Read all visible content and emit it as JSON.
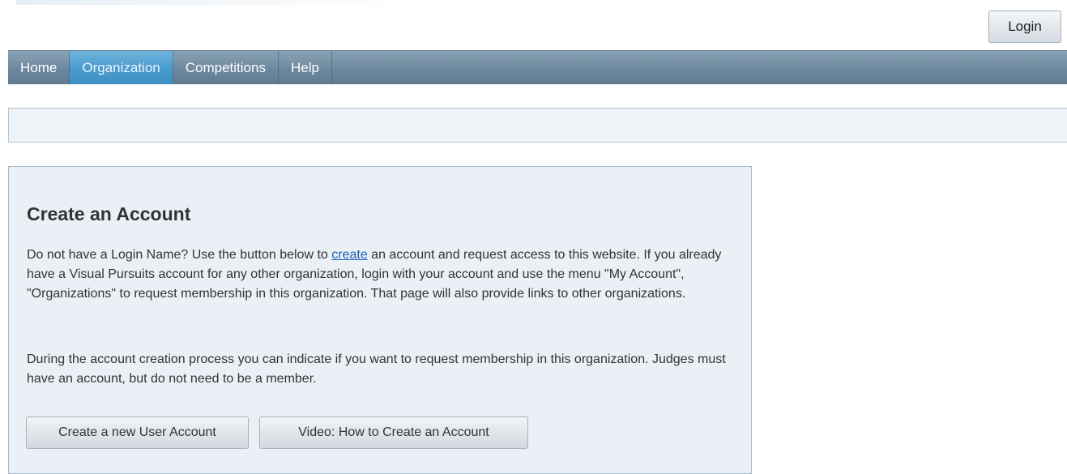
{
  "header": {
    "login_label": "Login"
  },
  "nav": {
    "items": [
      {
        "label": "Home",
        "active": false
      },
      {
        "label": "Organization",
        "active": true
      },
      {
        "label": "Competitions",
        "active": false
      },
      {
        "label": "Help",
        "active": false
      }
    ]
  },
  "panel": {
    "title": "Create an Account",
    "p1_before": "Do not have a Login Name? Use the button below to ",
    "p1_link": "create",
    "p1_after": " an account and request access to this website. If you already have a Visual Pursuits account for any other organization, login with your account and use the menu \"My Account\", \"Organizations\" to request membership in this organization. That page will also provide links to other organizations.",
    "p2": "During the account creation process you can indicate if you want to request membership in this organization. Judges must have an account, but do not need to be a member.",
    "create_button_label": "Create a new User Account",
    "video_button_label": "Video: How to Create an Account"
  },
  "colors": {
    "nav_bar": "#6d889e",
    "nav_active": "#4a9bcf",
    "panel_bg": "#eaf0f6",
    "link": "#1a5fb4"
  }
}
